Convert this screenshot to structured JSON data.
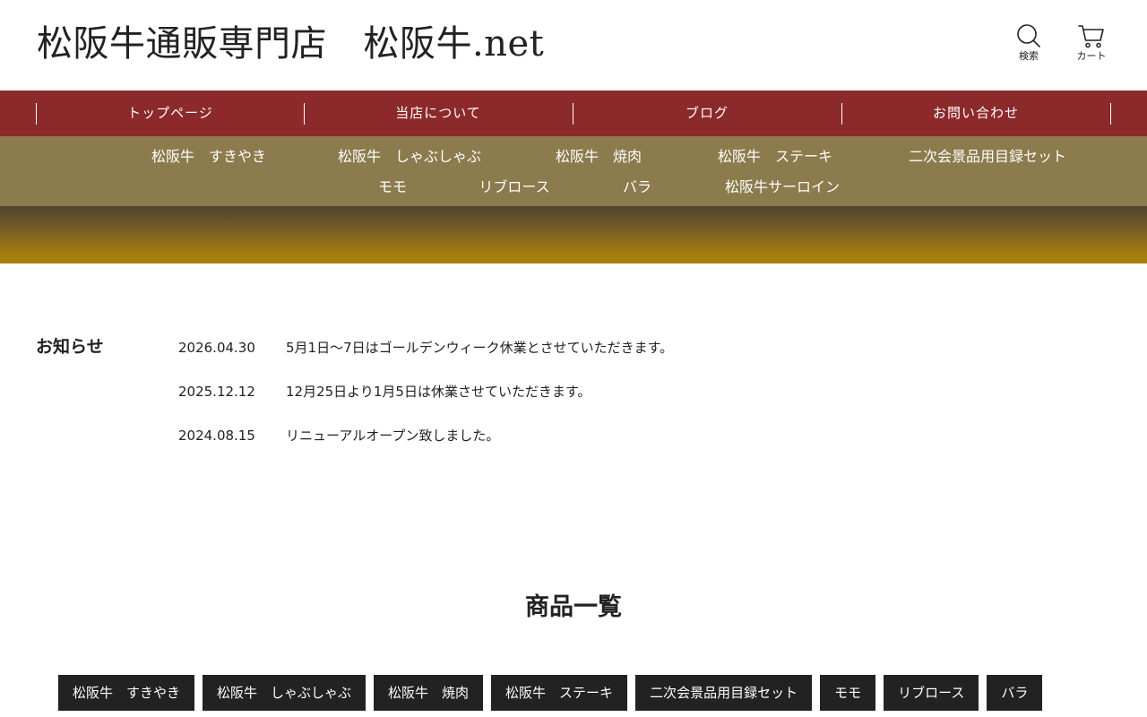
{
  "header": {
    "site_title": "松阪牛通販専門店　松阪牛.net",
    "search_label": "検索",
    "cart_label": "カート"
  },
  "main_nav": [
    {
      "label": "トップページ"
    },
    {
      "label": "当店について"
    },
    {
      "label": "ブログ"
    },
    {
      "label": "お問い合わせ"
    }
  ],
  "sub_nav": {
    "row1": [
      "松阪牛　すきやき",
      "松阪牛　しゃぶしゃぶ",
      "松阪牛　焼肉",
      "松阪牛　ステーキ",
      "二次会景品用目録セット"
    ],
    "row2": [
      "モモ",
      "リブロース",
      "バラ",
      "松阪牛サーロイン"
    ]
  },
  "news": {
    "heading": "お知らせ",
    "items": [
      {
        "date": "2026.04.30",
        "text": "5月1日〜7日はゴールデンウィーク休業とさせていただきます。"
      },
      {
        "date": "2025.12.12",
        "text": "12月25日より1月5日は休業させていただきます。"
      },
      {
        "date": "2024.08.15",
        "text": "リニューアルオープン致しました。"
      }
    ]
  },
  "products": {
    "title": "商品一覧",
    "categories": [
      "松阪牛　すきやき",
      "松阪牛　しゃぶしゃぶ",
      "松阪牛　焼肉",
      "松阪牛　ステーキ",
      "二次会景品用目録セット",
      "モモ",
      "リブロース",
      "バラ"
    ]
  },
  "colors": {
    "main_nav_bg": "#8c292b",
    "sub_nav_bg": "#8c7b4c",
    "category_button_bg": "#222222",
    "hero_band": "#a9800d"
  }
}
